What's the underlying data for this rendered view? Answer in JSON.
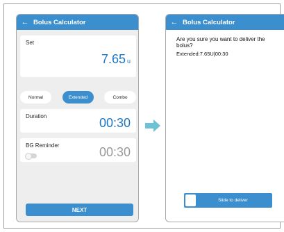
{
  "left_screen": {
    "title": "Bolus Calculator",
    "set_label": "Set",
    "set_value": "7.65",
    "set_unit": "u",
    "modes": [
      {
        "label": "Normal",
        "active": false
      },
      {
        "label": "Extended",
        "active": true
      },
      {
        "label": "Combo",
        "active": false
      }
    ],
    "duration_label": "Duration",
    "duration_value": "00:30",
    "bg_label": "BG Reminder",
    "bg_value": "00:30",
    "bg_toggle_on": false,
    "next_label": "NEXT"
  },
  "right_screen": {
    "title": "Bolus Calculator",
    "question": "Are you sure you want to deliver the bolus?",
    "summary": "Extended:7.65U|00:30",
    "slide_label": "Slide to deliver"
  },
  "colors": {
    "accent": "#3b8fce",
    "value_blue": "#1f78c4",
    "arrow": "#6cc3d5"
  }
}
